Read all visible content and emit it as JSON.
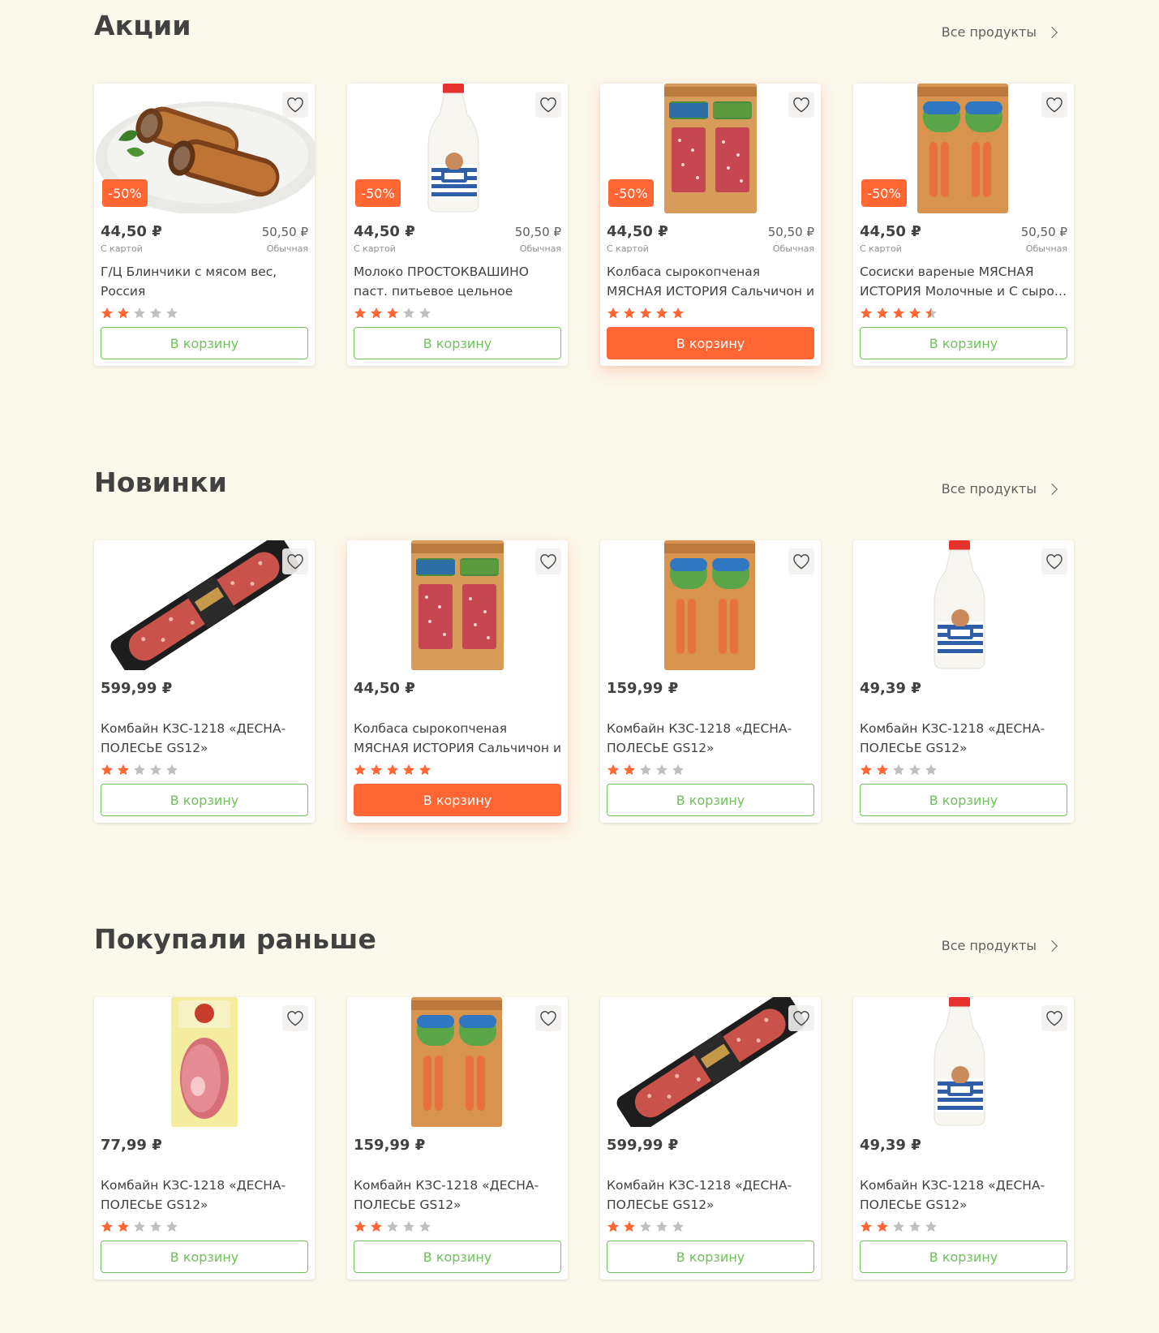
{
  "colors": {
    "background": "#fbf8ec",
    "accent": "#ff6633",
    "green": "#70c05b",
    "text": "#414141",
    "star_off": "#bfbfbf"
  },
  "sections": [
    {
      "title": "Акции",
      "all_link": "Все продукты",
      "products": [
        {
          "image": "pancakes",
          "discount": "-50%",
          "price": "44,50 ₽",
          "price_label": "С картой",
          "old_price": "50,50 ₽",
          "old_label": "Обычная",
          "name": "Г/Ц Блинчики с мясом вес, Россия",
          "rating": 2,
          "button": "В корзину",
          "highlight": false
        },
        {
          "image": "milk",
          "discount": "-50%",
          "price": "44,50 ₽",
          "price_label": "С картой",
          "old_price": "50,50 ₽",
          "old_label": "Обычная",
          "name": "Молоко ПРОСТОКВАШИНО паст. питьевое цельное отборное…",
          "rating": 3,
          "button": "В корзину",
          "highlight": false
        },
        {
          "image": "salami-pack",
          "discount": "-50%",
          "price": "44,50 ₽",
          "price_label": "С картой",
          "old_price": "50,50 ₽",
          "old_label": "Обычная",
          "name": "Колбаса сырокопченая МЯСНАЯ ИСТОРИЯ Сальчичон и Тоскан…",
          "rating": 5,
          "button": "В корзину",
          "highlight": true
        },
        {
          "image": "sausages-pack",
          "discount": "-50%",
          "price": "44,50 ₽",
          "price_label": "С картой",
          "old_price": "50,50 ₽",
          "old_label": "Обычная",
          "name": "Сосиски вареные МЯСНАЯ ИСТОРИЯ Молочные и С сыро…",
          "rating": 4.5,
          "button": "В корзину",
          "highlight": false
        }
      ]
    },
    {
      "title": "Новинки",
      "all_link": "Все продукты",
      "products": [
        {
          "image": "salami-stick",
          "price": "599,99 ₽",
          "name": "Комбайн КЗС-1218 «ДЕСНА-ПОЛЕСЬЕ GS12»",
          "rating": 2,
          "button": "В корзину",
          "highlight": false
        },
        {
          "image": "salami-pack",
          "price": "44,50 ₽",
          "name": "Колбаса сырокопченая МЯСНАЯ ИСТОРИЯ Сальчичон и Тоскан…",
          "rating": 5,
          "button": "В корзину",
          "highlight": true
        },
        {
          "image": "sausages-pack",
          "price": "159,99 ₽",
          "name": "Комбайн КЗС-1218 «ДЕСНА-ПОЛЕСЬЕ GS12»",
          "rating": 2,
          "button": "В корзину",
          "highlight": false
        },
        {
          "image": "milk",
          "price": "49,39 ₽",
          "name": "Комбайн КЗС-1218 «ДЕСНА-ПОЛЕСЬЕ GS12»",
          "rating": 2,
          "button": "В корзину",
          "highlight": false
        }
      ]
    },
    {
      "title": "Покупали раньше",
      "all_link": "Все продукты",
      "products": [
        {
          "image": "ham-pack",
          "price": "77,99 ₽",
          "name": "Комбайн КЗС-1218 «ДЕСНА-ПОЛЕСЬЕ GS12»",
          "rating": 2,
          "button": "В корзину",
          "highlight": false
        },
        {
          "image": "sausages-pack",
          "price": "159,99 ₽",
          "name": "Комбайн КЗС-1218 «ДЕСНА-ПОЛЕСЬЕ GS12»",
          "rating": 2,
          "button": "В корзину",
          "highlight": false
        },
        {
          "image": "salami-stick",
          "price": "599,99 ₽",
          "name": "Комбайн КЗС-1218 «ДЕСНА-ПОЛЕСЬЕ GS12»",
          "rating": 2,
          "button": "В корзину",
          "highlight": false
        },
        {
          "image": "milk",
          "price": "49,39 ₽",
          "name": "Комбайн КЗС-1218 «ДЕСНА-ПОЛЕСЬЕ GS12»",
          "rating": 2,
          "button": "В корзину",
          "highlight": false
        }
      ]
    }
  ]
}
